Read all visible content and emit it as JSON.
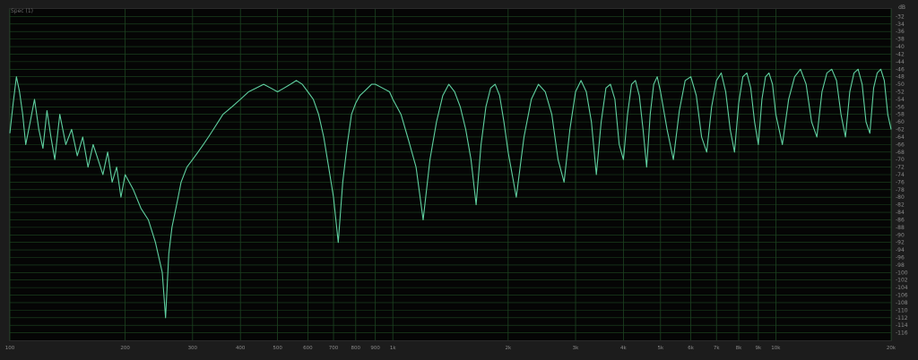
{
  "header": {
    "channel_label": "Spec (1)",
    "unit_label": "dB"
  },
  "colors": {
    "background": "#050505",
    "grid": "#1e4a22",
    "trace": "#5fd0a0",
    "text": "#8a8a8a"
  },
  "chart_data": {
    "type": "line",
    "title": "",
    "xlabel": "",
    "ylabel": "dB",
    "x_scale": "log",
    "xlim": [
      100,
      20000
    ],
    "ylim": [
      -118,
      -30
    ],
    "grid": true,
    "x_ticks": [
      {
        "value": 100,
        "label": "100"
      },
      {
        "value": 200,
        "label": "200"
      },
      {
        "value": 300,
        "label": "300"
      },
      {
        "value": 400,
        "label": "400"
      },
      {
        "value": 500,
        "label": "500"
      },
      {
        "value": 600,
        "label": "600"
      },
      {
        "value": 700,
        "label": "700"
      },
      {
        "value": 800,
        "label": "800"
      },
      {
        "value": 900,
        "label": "900"
      },
      {
        "value": 1000,
        "label": "1k"
      },
      {
        "value": 2000,
        "label": "2k"
      },
      {
        "value": 3000,
        "label": "3k"
      },
      {
        "value": 4000,
        "label": "4k"
      },
      {
        "value": 5000,
        "label": "5k"
      },
      {
        "value": 6000,
        "label": "6k"
      },
      {
        "value": 7000,
        "label": "7k"
      },
      {
        "value": 8000,
        "label": "8k"
      },
      {
        "value": 9000,
        "label": "9k"
      },
      {
        "value": 10000,
        "label": "10k"
      },
      {
        "value": 20000,
        "label": "20k"
      }
    ],
    "y_ticks": [
      -32,
      -34,
      -36,
      -38,
      -40,
      -42,
      -44,
      -46,
      -48,
      -50,
      -52,
      -54,
      -56,
      -58,
      -60,
      -62,
      -64,
      -66,
      -68,
      -70,
      -72,
      -74,
      -76,
      -78,
      -80,
      -82,
      -84,
      -86,
      -88,
      -90,
      -92,
      -94,
      -96,
      -98,
      -100,
      -102,
      -104,
      -106,
      -108,
      -110,
      -112,
      -114,
      -116
    ],
    "series": [
      {
        "values_description_free": true,
        "x": [
          100,
          102,
          104,
          106,
          108,
          110,
          113,
          116,
          119,
          122,
          125,
          128,
          131,
          135,
          140,
          145,
          150,
          155,
          160,
          165,
          170,
          175,
          180,
          185,
          190,
          195,
          200,
          210,
          220,
          230,
          240,
          250,
          255,
          260,
          265,
          270,
          275,
          280,
          290,
          300,
          310,
          320,
          330,
          340,
          350,
          360,
          380,
          400,
          420,
          440,
          460,
          480,
          500,
          520,
          540,
          560,
          580,
          600,
          620,
          640,
          660,
          680,
          700,
          720,
          740,
          760,
          780,
          800,
          820,
          840,
          860,
          880,
          900,
          940,
          980,
          1000,
          1050,
          1100,
          1150,
          1200,
          1250,
          1300,
          1350,
          1400,
          1450,
          1500,
          1550,
          1600,
          1650,
          1700,
          1750,
          1800,
          1850,
          1900,
          1950,
          2000,
          2100,
          2200,
          2300,
          2400,
          2500,
          2600,
          2700,
          2800,
          2900,
          3000,
          3100,
          3200,
          3300,
          3400,
          3500,
          3600,
          3700,
          3800,
          3900,
          4000,
          4100,
          4200,
          4300,
          4400,
          4500,
          4600,
          4700,
          4800,
          4900,
          5000,
          5200,
          5400,
          5600,
          5800,
          6000,
          6200,
          6400,
          6600,
          6800,
          7000,
          7200,
          7400,
          7600,
          7800,
          8000,
          8200,
          8400,
          8600,
          8800,
          9000,
          9200,
          9400,
          9600,
          9800,
          10000,
          10400,
          10800,
          11200,
          11600,
          12000,
          12400,
          12800,
          13200,
          13600,
          14000,
          14400,
          14800,
          15200,
          15600,
          16000,
          16400,
          16800,
          17200,
          17600,
          18000,
          18400,
          18800,
          19200,
          19600,
          20000
        ],
        "y": [
          -63,
          -55,
          -48,
          -52,
          -58,
          -66,
          -60,
          -54,
          -62,
          -67,
          -57,
          -64,
          -70,
          -58,
          -66,
          -62,
          -69,
          -64,
          -72,
          -66,
          -70,
          -74,
          -68,
          -76,
          -72,
          -80,
          -74,
          -78,
          -83,
          -86,
          -92,
          -100,
          -112,
          -95,
          -88,
          -84,
          -80,
          -76,
          -72,
          -70,
          -68,
          -66,
          -64,
          -62,
          -60,
          -58,
          -56,
          -54,
          -52,
          -51,
          -50,
          -51,
          -52,
          -51,
          -50,
          -49,
          -50,
          -52,
          -54,
          -58,
          -64,
          -72,
          -80,
          -92,
          -76,
          -66,
          -58,
          -55,
          -53,
          -52,
          -51,
          -50,
          -50,
          -51,
          -52,
          -54,
          -58,
          -65,
          -72,
          -86,
          -70,
          -60,
          -53,
          -50,
          -52,
          -56,
          -62,
          -70,
          -82,
          -66,
          -56,
          -51,
          -50,
          -53,
          -60,
          -68,
          -80,
          -64,
          -54,
          -50,
          -52,
          -58,
          -70,
          -76,
          -62,
          -52,
          -49,
          -52,
          -60,
          -74,
          -60,
          -51,
          -50,
          -54,
          -66,
          -70,
          -58,
          -50,
          -49,
          -53,
          -62,
          -72,
          -58,
          -50,
          -48,
          -52,
          -62,
          -70,
          -57,
          -49,
          -48,
          -53,
          -64,
          -68,
          -56,
          -49,
          -47,
          -52,
          -62,
          -68,
          -55,
          -48,
          -47,
          -51,
          -60,
          -66,
          -54,
          -48,
          -47,
          -50,
          -58,
          -66,
          -54,
          -48,
          -46,
          -50,
          -60,
          -64,
          -52,
          -47,
          -46,
          -49,
          -58,
          -64,
          -52,
          -47,
          -46,
          -50,
          -60,
          -63,
          -51,
          -47,
          -46,
          -49,
          -58,
          -62
        ],
        "name": ""
      }
    ]
  }
}
